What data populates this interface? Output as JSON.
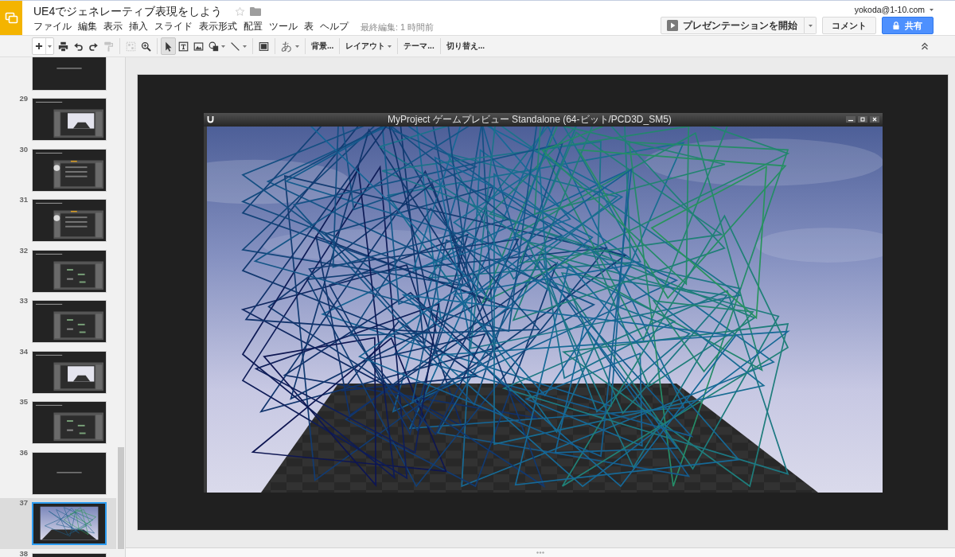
{
  "header": {
    "title": "UE4でジェネレーティブ表現をしよう",
    "starred": false,
    "last_edit": "最終編集: 1 時間前",
    "account": "yokoda@1-10.com"
  },
  "menu": [
    "ファイル",
    "編集",
    "表示",
    "挿入",
    "スライド",
    "表示形式",
    "配置",
    "ツール",
    "表",
    "ヘルプ"
  ],
  "actions": {
    "present": "プレゼンテーションを開始",
    "comment": "コメント",
    "share": "共有"
  },
  "toolbar": [
    [
      {
        "kind": "split",
        "disabled": false,
        "menu": true
      },
      {
        "kind": "icon",
        "disabled": false,
        "menu": false
      },
      {
        "kind": "icon",
        "disabled": false,
        "menu": false
      },
      {
        "kind": "icon",
        "disabled": false,
        "menu": false
      },
      {
        "kind": "icon",
        "disabled": true,
        "menu": false
      }
    ],
    [
      {
        "kind": "icon",
        "disabled": true,
        "menu": false
      },
      {
        "kind": "icon",
        "disabled": false,
        "menu": false
      }
    ],
    [
      {
        "kind": "tool",
        "selected": true,
        "disabled": false,
        "menu": false
      },
      {
        "kind": "tool",
        "selected": false,
        "disabled": false,
        "menu": false
      },
      {
        "kind": "tool",
        "selected": false,
        "disabled": false,
        "menu": false
      },
      {
        "kind": "tool",
        "selected": false,
        "disabled": false,
        "menu": true
      },
      {
        "kind": "tool",
        "selected": false,
        "disabled": false,
        "menu": true
      }
    ],
    [
      {
        "kind": "icon",
        "disabled": false,
        "menu": false
      }
    ],
    [
      {
        "kind": "glyph",
        "label": "あ",
        "disabled": false,
        "menu": true
      }
    ],
    [
      {
        "kind": "text",
        "label": "背景...",
        "disabled": false,
        "menu": false
      }
    ],
    [
      {
        "kind": "text",
        "label": "レイアウト",
        "disabled": false,
        "menu": true
      }
    ],
    [
      {
        "kind": "text",
        "label": "テーマ...",
        "disabled": false,
        "menu": false
      }
    ],
    [
      {
        "kind": "text",
        "label": "切り替え...",
        "disabled": false,
        "menu": false
      }
    ]
  ],
  "slides": [
    {
      "kind": "title",
      "selected": false
    },
    {
      "number": "29",
      "kind": "viewport",
      "selected": false
    },
    {
      "number": "30",
      "kind": "material",
      "selected": false
    },
    {
      "number": "31",
      "kind": "material",
      "selected": false
    },
    {
      "number": "32",
      "kind": "editor",
      "selected": false
    },
    {
      "number": "33",
      "kind": "editor",
      "selected": false
    },
    {
      "number": "34",
      "kind": "viewport",
      "selected": false
    },
    {
      "number": "35",
      "kind": "editor",
      "selected": false
    },
    {
      "number": "36",
      "kind": "title",
      "selected": false
    },
    {
      "number": "37",
      "kind": "scene",
      "selected": true
    },
    {
      "number": "38",
      "kind": "title",
      "selected": false
    }
  ],
  "slide": {
    "window_title": "MyProject ゲームプレビュー Standalone (64-ビット/PCD3D_SM5)"
  }
}
